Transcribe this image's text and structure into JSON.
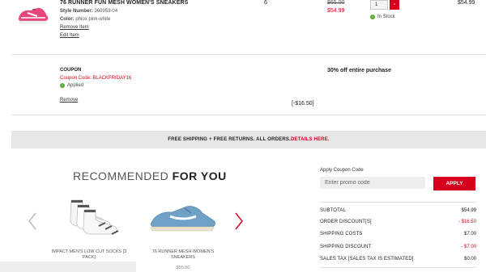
{
  "cart_item": {
    "name": "76 RUNNER FUN MESH WOMEN'S SNEAKERS",
    "style_label": "Style Number:",
    "style_number": "360953-04",
    "color_label": "Color:",
    "color_value": "phlox pink-white",
    "remove_label": "Remove Item",
    "edit_label": "Edit Item",
    "size": "6",
    "old_price": "$65.00",
    "new_price": "$54.99",
    "quantity": "1",
    "qty_button": "-",
    "stock_status": "In Stock",
    "line_total": "$54.99"
  },
  "coupon": {
    "title": "COUPON",
    "code_text": "Coupon Code: BLACKFRIDAY16",
    "status": "Applied",
    "remove_label": "Remove",
    "amount": "[-$16.50]",
    "description": "30% off entire purchase"
  },
  "shipping_banner": {
    "text": "FREE SHIPPING + FREE RETURNS. ALL ORDERS.",
    "link": "DETAILS HERE."
  },
  "recommended": {
    "title_light": "RECOMMENDED",
    "title_bold": "FOR YOU",
    "products": [
      {
        "name": "IMPACT MEN'S LOW CUT SOCKS [3 PACK]",
        "price": ""
      },
      {
        "name": "76 RUNNER MESH WOMEN'S SNEAKERS",
        "price": "$55.00"
      }
    ]
  },
  "promo": {
    "label": "Apply Coupon Code",
    "placeholder": "Enter promo code",
    "button": "APPLY"
  },
  "summary": {
    "rows": [
      {
        "label": "SUBTOTAL",
        "value": "$54.99"
      },
      {
        "label": "ORDER DISCOUNT[S]",
        "value": "- $16.50"
      },
      {
        "label": "SHIPPING COSTS",
        "value": "$7.00"
      },
      {
        "label": "SHIPPING DISCOUNT",
        "value": "- $7.00"
      },
      {
        "label": "SALES TAX [SALES TAX IS ESTIMATED]",
        "value": "$0.00"
      }
    ]
  },
  "colors": {
    "accent": "#d6001c",
    "success": "#5aa832",
    "banner_bg": "#e6e6e6"
  }
}
